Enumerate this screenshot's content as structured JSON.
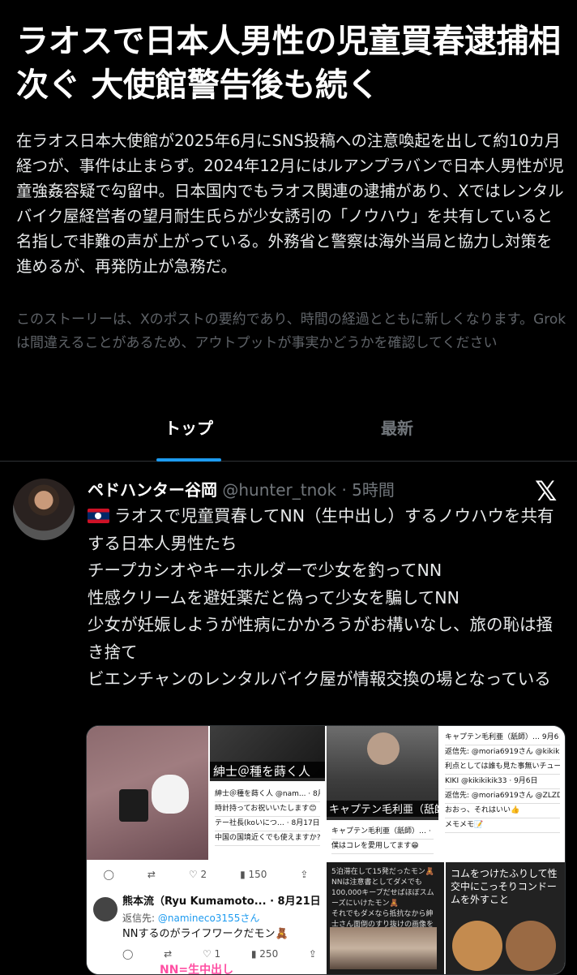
{
  "story": {
    "headline": "ラオスで日本人男性の児童買春逮捕相次ぐ 大使館警告後も続く",
    "summary": "在ラオス日本大使館が2025年6月にSNS投稿への注意喚起を出して約10カ月経つが、事件は止まらず。2024年12月にはルアンプラバンで日本人男性が児童強姦容疑で勾留中。日本国内でもラオス関連の逮捕があり、Xではレンタルバイク屋経営者の望月耐生氏らが少女誘引の「ノウハウ」を共有していると名指しで非難の声が上がっている。外務省と警察は海外当局と協力し対策を進めるが、再発防止が急務だ。",
    "disclaimer": "このストーリーは、Xのポストの要約であり、時間の経過とともに新しくなります。Grokは間違えることがあるため、アウトプットが事実かどうかを確認してください"
  },
  "tabs": [
    {
      "label": "トップ",
      "active": true
    },
    {
      "label": "最新",
      "active": false
    }
  ],
  "post": {
    "author_name": "ペドハンター谷岡",
    "author_handle": "@hunter_tnok",
    "time": "· 5時間",
    "platform_icon": "x-logo-icon",
    "flag_icon": "laos-flag-icon",
    "lines": [
      "ラオスで児童買春してNN（生中出し）するノウハウを共有する日本人男性たち",
      "チープカシオやキーホルダーで少女を釣ってNN",
      "性感クリームを避妊薬だと偽って少女を騙してNN",
      "少女が妊娠しようが性病にかかろうがお構いなし、旅の恥は掻き捨て",
      "ビエンチャンのレンタルバイク屋が情報交換の場となっている"
    ],
    "media": {
      "caption_1": "紳士＠種を蒔く人",
      "caption_2": "キャプテン毛利亜（舐師）",
      "ss1_lines": [
        "紳士＠種を蒔く人 @nam... · 8月17日",
        "時計持ってお祝いいたします😊",
        "テー社長(koいにつ… · 8月17日",
        "中国の国境近くでも使えますか?"
      ],
      "ss2_lines": [
        "キャプテン毛利亜（舐師）… · 9月5日",
        "僕はコレを愛用してます😁"
      ],
      "ss3_lines": [
        "キャプテン毛利亜（舐師）… 9月6日",
        "返信先: @moria6919さん @kikikikik33さん @ZLZD41さん",
        "利点としては誰も見た事無いチューブなので避妊薬だと言うと信じてくれる。",
        "KIKI @kikikikik33 · 9月6日",
        "返信先: @moria6919さん @ZLZD41さん",
        "おおっ、それはいい👍",
        "メモメモ📝"
      ],
      "thumb_counts": {
        "replies": "2",
        "views": "150"
      },
      "reply": {
        "name": "熊本流（Ryu Kumamoto...",
        "date": "· 8月21日",
        "reply_to_label": "返信先:",
        "reply_to_handle": "@namineco3155さん",
        "text": "NNするのがライフワークだモン🧸",
        "count_replies": "1",
        "count_views": "250"
      },
      "pink_caption": "NN=生中出し",
      "dark_text": [
        "5泊滞在して15発だったモン🧸",
        "NNは注意書としてダメでも100,000キープだせばほぼスムーズにいけたモン🧸",
        "それでもダメなら抵抗なから紳士さん面倒のすり抜けの画像を使ってみてほしいモン"
      ],
      "dolls_text": "コムをつけたふりして性交中にこっそりコンドームを外すこと"
    }
  }
}
